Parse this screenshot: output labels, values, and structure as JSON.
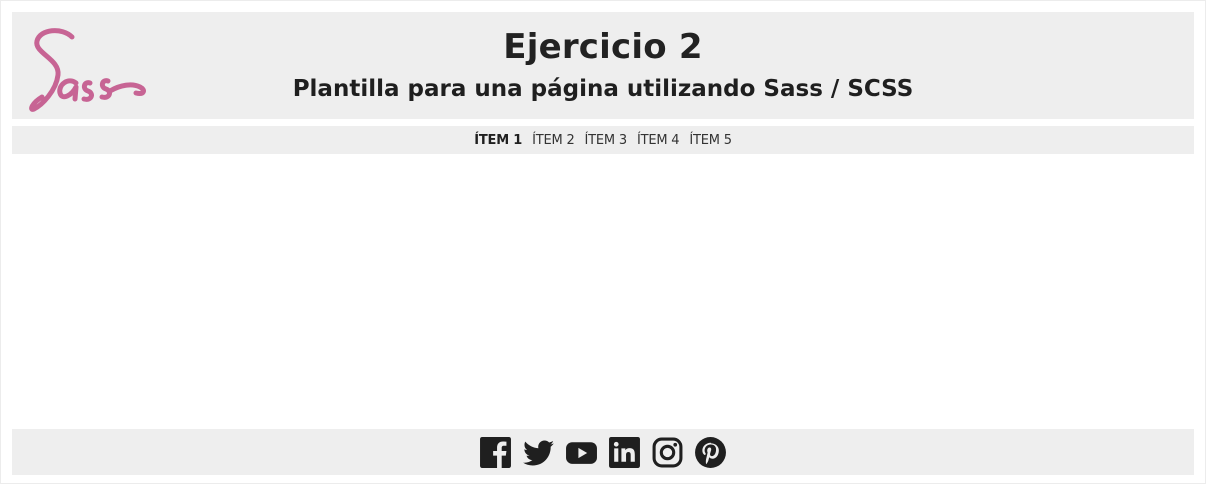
{
  "header": {
    "logo_text": "Sass",
    "title": "Ejercicio 2",
    "subtitle": "Plantilla para una página utilizando Sass / SCSS"
  },
  "nav": {
    "items": [
      {
        "label": "ÍTEM 1",
        "active": true
      },
      {
        "label": "ÍTEM 2",
        "active": false
      },
      {
        "label": "ÍTEM 3",
        "active": false
      },
      {
        "label": "ÍTEM 4",
        "active": false
      },
      {
        "label": "ÍTEM 5",
        "active": false
      }
    ]
  },
  "footer": {
    "social_icons": [
      "facebook-icon",
      "twitter-icon",
      "youtube-icon",
      "linkedin-icon",
      "instagram-icon",
      "pinterest-icon"
    ]
  },
  "colors": {
    "brand_pink": "#c76494",
    "panel_bg": "#eeeeee",
    "text_dark": "#222222"
  }
}
